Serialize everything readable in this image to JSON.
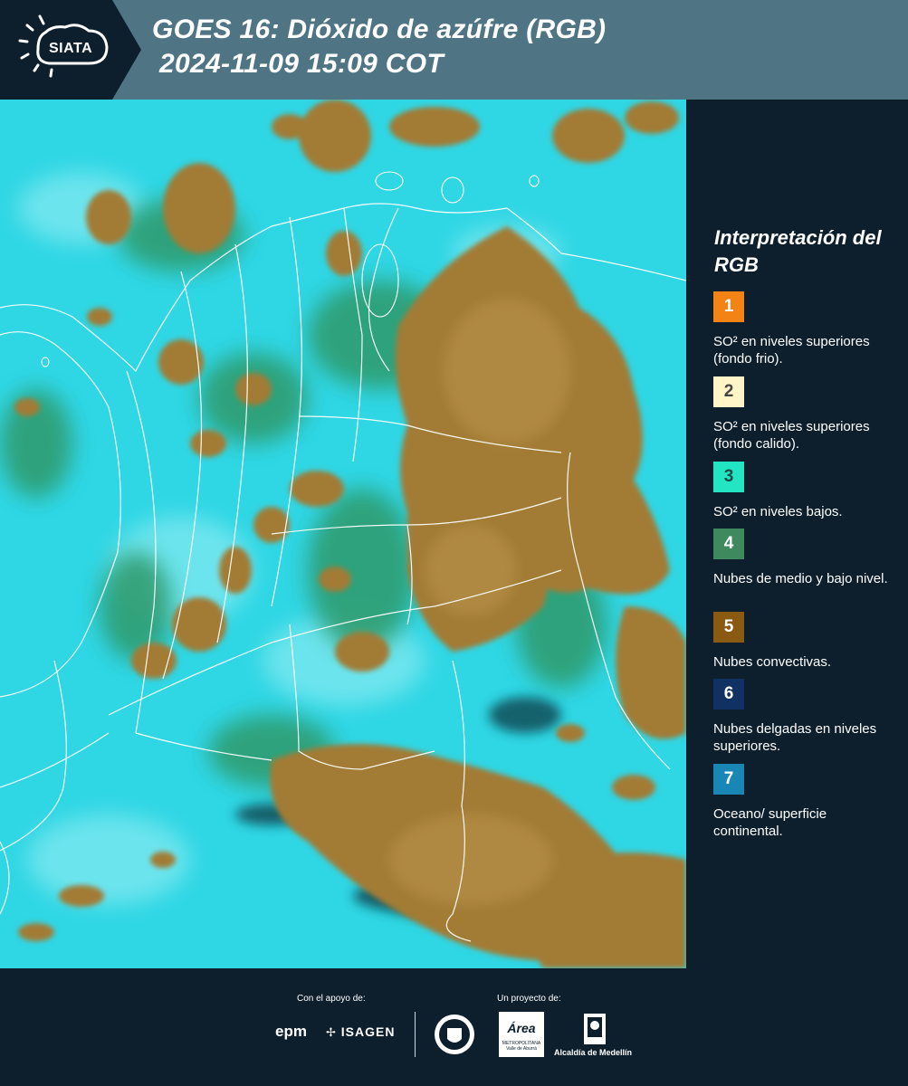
{
  "header": {
    "logo_text": "SIATA",
    "title_line1": "GOES 16: Dióxido de azúfre (RGB)",
    "title_line2": "2024-11-09 15:09 COT",
    "background_color": "#4f7585"
  },
  "legend": {
    "title": "Interpretación del RGB",
    "items": [
      {
        "number": "1",
        "color": "#f28314",
        "text_color": "#ffffff",
        "label": "SO² en niveles superiores (fondo frio)."
      },
      {
        "number": "2",
        "color": "#fff5c8",
        "text_color": "#444444",
        "label": "SO² en niveles superiores (fondo calido)."
      },
      {
        "number": "3",
        "color": "#22e5c4",
        "text_color": "#1a4a48",
        "label": "SO² en niveles bajos."
      },
      {
        "number": "4",
        "color": "#3e8a5e",
        "text_color": "#ffffff",
        "label": "Nubes de medio y bajo nivel."
      },
      {
        "number": "5",
        "color": "#8a5a12",
        "text_color": "#ffffff",
        "label": "Nubes convectivas."
      },
      {
        "number": "6",
        "color": "#0f3163",
        "text_color": "#ffffff",
        "label": "Nubes delgadas en niveles superiores."
      },
      {
        "number": "7",
        "color": "#1887b5",
        "text_color": "#ffffff",
        "label": "Oceano/ superficie continental."
      }
    ]
  },
  "map": {
    "cyan_color": "#2fd6e4",
    "convective_color": "#a27c34",
    "green_color": "#2f9a6b",
    "border_color": "#ffffff"
  },
  "footer": {
    "support_label": "Con el apoyo de:",
    "project_label": "Un proyecto de:",
    "sponsors": {
      "epm": "epm",
      "isagen": "ISAGEN",
      "area_metro": "Área",
      "area_metro_sub1": "METROPOLITANA",
      "area_metro_sub2": "Valle de Aburrá",
      "alcaldia": "Alcaldía de Medellín"
    }
  }
}
